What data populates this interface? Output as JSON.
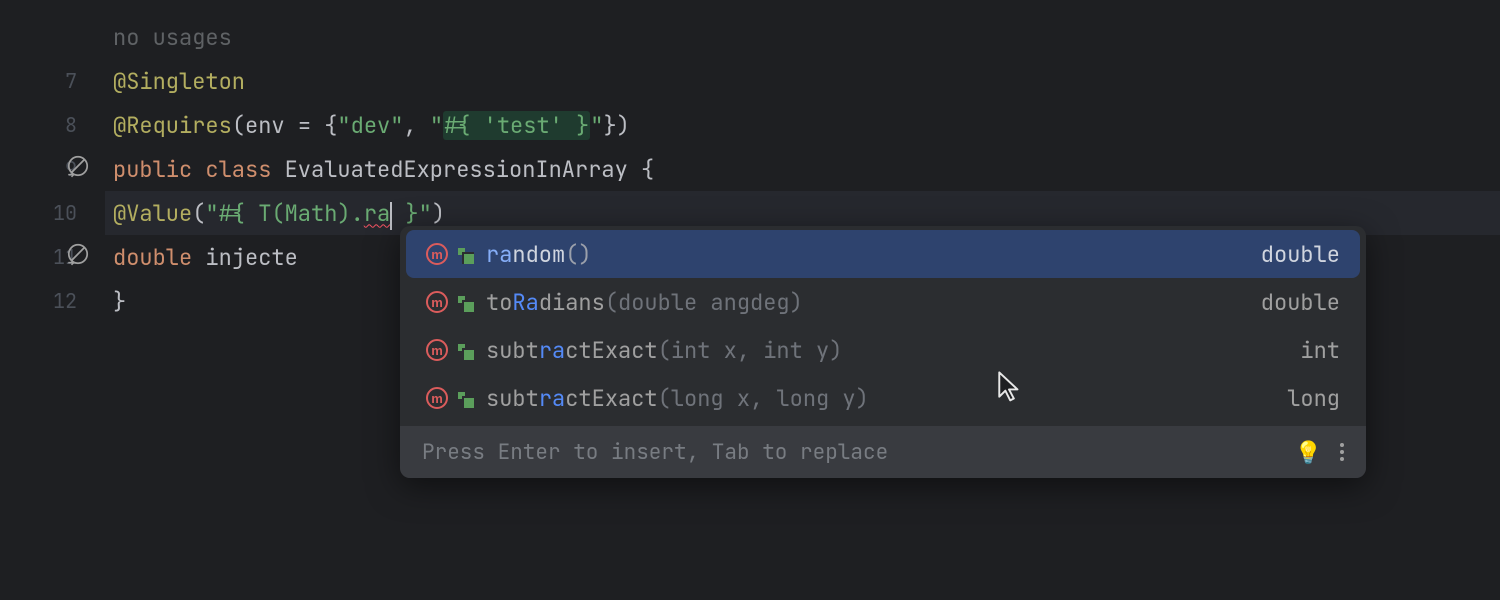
{
  "gutter": {
    "lines": [
      "",
      "7",
      "8",
      "9",
      "10",
      "11",
      "12"
    ]
  },
  "hints": {
    "no_usages": "no usages"
  },
  "code": {
    "singleton": "@Singleton",
    "requires_ann": "@Requires",
    "requires_paren_open": "(env = {",
    "requires_str1": "\"dev\"",
    "requires_comma": ", ",
    "requires_str2a": "\"",
    "requires_str2b_hl": "#{ 'test' }",
    "requires_str2c": "\"",
    "requires_paren_close": "})",
    "pub": "public ",
    "cls": "class ",
    "clsname": "EvaluatedExpressionInArray ",
    "brace_open": "{",
    "value_ann": "@Value",
    "value_open": "(",
    "value_str_a": "\"#{ T(Math).",
    "value_str_b": "ra",
    "value_str_c": " }\"",
    "value_close": ")",
    "field_type": "double ",
    "field_name": "injecte",
    "brace_close": "}"
  },
  "completion": {
    "match_query": "ra",
    "items": [
      {
        "pre": "",
        "match": "ra",
        "post": "ndom",
        "params": "()",
        "ret": "double",
        "selected": true
      },
      {
        "pre": "to",
        "match": "Ra",
        "post": "dians",
        "params": "(double angdeg)",
        "ret": "double",
        "selected": false
      },
      {
        "pre": "subt",
        "match": "ra",
        "post": "ctExact",
        "params": "(int x, int y)",
        "ret": "int",
        "selected": false
      },
      {
        "pre": "subt",
        "match": "ra",
        "post": "ctExact",
        "params": "(long x, long y)",
        "ret": "long",
        "selected": false
      }
    ],
    "footer": "Press Enter to insert, Tab to replace"
  },
  "icons": {
    "method_badge": "m"
  }
}
